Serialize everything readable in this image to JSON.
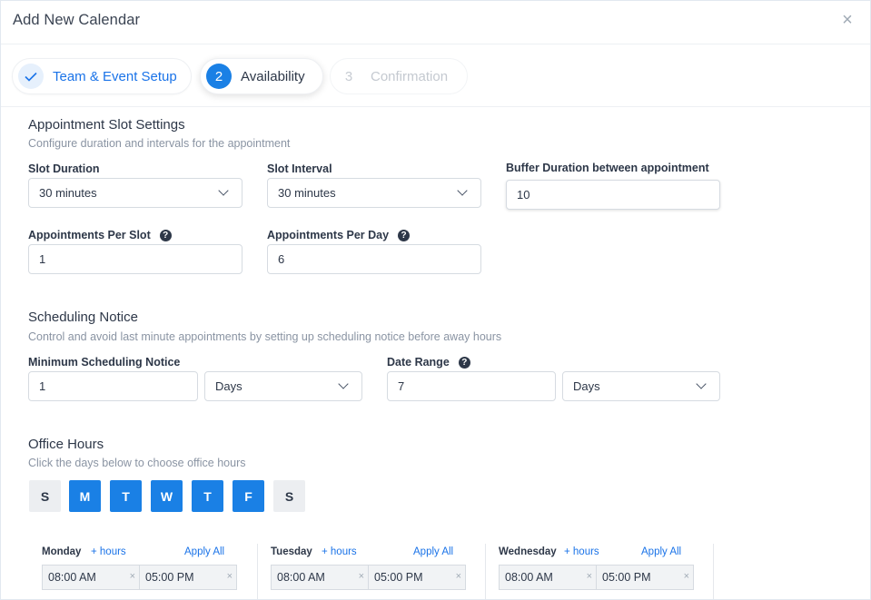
{
  "dialog": {
    "title": "Add New Calendar",
    "close_glyph": "×"
  },
  "stepper": {
    "steps": [
      {
        "number": "1",
        "label": "Team & Event Setup",
        "state": "done",
        "icon": "check-icon"
      },
      {
        "number": "2",
        "label": "Availability",
        "state": "active"
      },
      {
        "number": "3",
        "label": "Confirmation",
        "state": "pending"
      }
    ]
  },
  "slot_settings": {
    "title": "Appointment Slot Settings",
    "desc": "Configure duration and intervals for the appointment",
    "slot_duration": {
      "label": "Slot Duration",
      "value": "30 minutes"
    },
    "slot_interval": {
      "label": "Slot Interval",
      "value": "30 minutes"
    },
    "buffer": {
      "label": "Buffer Duration between appointment",
      "value": "10"
    },
    "per_slot": {
      "label": "Appointments Per Slot",
      "value": "1"
    },
    "per_day": {
      "label": "Appointments Per Day",
      "value": "6"
    }
  },
  "scheduling": {
    "title": "Scheduling Notice",
    "desc": "Control and avoid last minute appointments by setting up scheduling notice before away hours",
    "min_notice": {
      "label": "Minimum Scheduling Notice",
      "value": "1",
      "unit": "Days"
    },
    "date_range": {
      "label": "Date Range",
      "value": "7",
      "unit": "Days"
    }
  },
  "office_hours": {
    "title": "Office Hours",
    "desc": "Click the days below to choose office hours",
    "days": [
      {
        "letter": "S",
        "selected": false
      },
      {
        "letter": "M",
        "selected": true
      },
      {
        "letter": "T",
        "selected": true
      },
      {
        "letter": "W",
        "selected": true
      },
      {
        "letter": "T",
        "selected": true
      },
      {
        "letter": "F",
        "selected": true
      },
      {
        "letter": "S",
        "selected": false
      }
    ],
    "columns": [
      {
        "day": "Monday",
        "add": "+ hours",
        "apply": "Apply All",
        "start": "08:00 AM",
        "end": "05:00 PM"
      },
      {
        "day": "Tuesday",
        "add": "+ hours",
        "apply": "Apply All",
        "start": "08:00 AM",
        "end": "05:00 PM"
      },
      {
        "day": "Wednesday",
        "add": "+ hours",
        "apply": "Apply All",
        "start": "08:00 AM",
        "end": "05:00 PM"
      }
    ],
    "clear_glyph": "×"
  },
  "colors": {
    "accent": "#1a80e5",
    "link": "#1a73e8",
    "day_off": "#eceef1"
  }
}
